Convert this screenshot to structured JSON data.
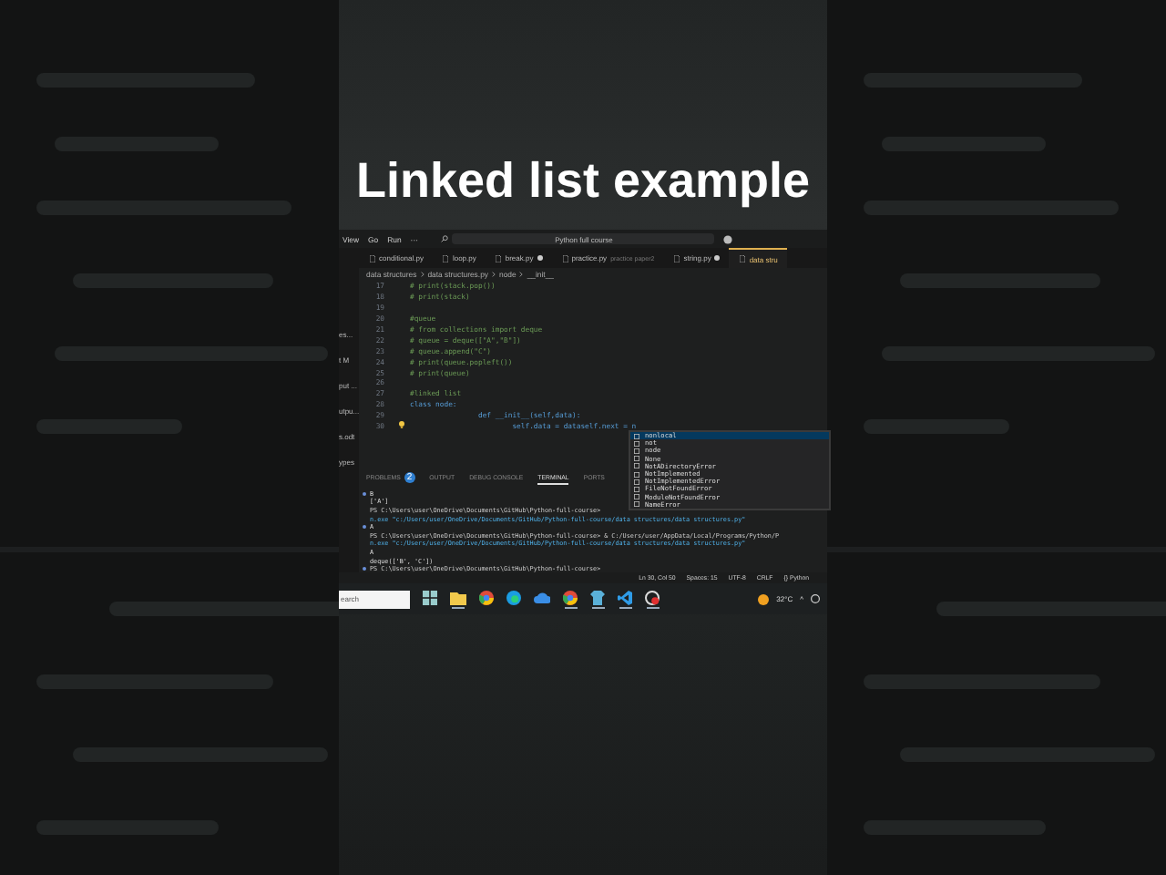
{
  "title": "Linked list example",
  "menu": [
    "View",
    "Go",
    "Run",
    "···"
  ],
  "command_center": {
    "placeholder": "Python full course"
  },
  "tabs": [
    {
      "label": "conditional.py",
      "modified": false,
      "selected": false
    },
    {
      "label": "loop.py",
      "modified": false,
      "selected": false
    },
    {
      "label": "break.py",
      "modified": true,
      "selected": false
    },
    {
      "label": "practice.py",
      "description": "practice paper2",
      "modified": false,
      "selected": false
    },
    {
      "label": "string.py",
      "modified": true,
      "selected": false
    },
    {
      "label": "data stru",
      "modified": false,
      "selected": true
    }
  ],
  "breadcrumb": [
    "data structures",
    "data structures.py",
    "node",
    "__init__"
  ],
  "sidebar": [
    "es...",
    "t M",
    "put ...",
    "utpu...",
    "s.odt",
    "ypes"
  ],
  "code": [
    {
      "num": "17",
      "kind": "comment",
      "text": "# print(stack.pop())",
      "hint": false
    },
    {
      "num": "18",
      "kind": "comment",
      "text": "# print(stack)",
      "hint": false
    },
    {
      "num": "19",
      "kind": "blank",
      "hint": false
    },
    {
      "num": "20",
      "kind": "comment",
      "text": "#queue",
      "hint": false
    },
    {
      "num": "21",
      "kind": "comment",
      "text": "# from collections import deque",
      "hint": false
    },
    {
      "num": "22",
      "kind": "comment",
      "text": "# queue = deque([\"A\",\"B\"])",
      "hint": false
    },
    {
      "num": "23",
      "kind": "comment",
      "text": "# queue.append(\"C\")",
      "hint": false
    },
    {
      "num": "24",
      "kind": "comment",
      "text": "# print(queue.popleft())",
      "hint": false
    },
    {
      "num": "25",
      "kind": "comment",
      "text": "# print(queue)",
      "hint": false
    },
    {
      "num": "26",
      "kind": "blank",
      "hint": false
    },
    {
      "num": "27",
      "kind": "comment",
      "text": "#linked list",
      "hint": false
    },
    {
      "num": "28",
      "kind": "code",
      "text": "class node:",
      "hint": false
    },
    {
      "num": "29",
      "kind": "code",
      "text": "                def __init__(self,data):",
      "hint": false
    },
    {
      "num": "30",
      "kind": "code",
      "text": "                        self.data = dataself.next = n",
      "hint": true
    }
  ],
  "suggestions": [
    {
      "label": "nonlocal",
      "selected": true
    },
    {
      "label": "not",
      "selected": false
    },
    {
      "label": "node",
      "selected": false
    },
    {
      "label": "None",
      "selected": false
    },
    {
      "label": "NotADirectoryError",
      "selected": false
    },
    {
      "label": "NotImplemented",
      "selected": false
    },
    {
      "label": "NotImplementedError",
      "selected": false
    },
    {
      "label": "FileNotFoundError",
      "selected": false
    },
    {
      "label": "ModuleNotFoundError",
      "selected": false
    },
    {
      "label": "NameError",
      "selected": false
    }
  ],
  "panel_tabs": [
    {
      "label": "PROBLEMS",
      "badge": "2",
      "selected": false
    },
    {
      "label": "OUTPUT",
      "selected": false
    },
    {
      "label": "DEBUG CONSOLE",
      "selected": false
    },
    {
      "label": "TERMINAL",
      "selected": true
    },
    {
      "label": "PORTS",
      "selected": false
    }
  ],
  "terminal": [
    {
      "kind": "output",
      "text": "B",
      "dot": true
    },
    {
      "kind": "output",
      "text": "['A']",
      "dot": false
    },
    {
      "kind": "prompt",
      "text": "PS C:\\Users\\user\\OneDrive\\Documents\\GitHub\\Python-full-course>",
      "dot": false
    },
    {
      "kind": "command",
      "text": "n.exe \"c:/Users/user/OneDrive/Documents/GitHub/Python-full-course/data structures/data structures.py\"",
      "dot": false
    },
    {
      "kind": "output",
      "text": "A",
      "dot": true
    },
    {
      "kind": "prompt",
      "text": "PS C:\\Users\\user\\OneDrive\\Documents\\GitHub\\Python-full-course> & C:/Users/user/AppData/Local/Programs/Python/P",
      "dot": false
    },
    {
      "kind": "command",
      "text": "n.exe \"c:/Users/user/OneDrive/Documents/GitHub/Python-full-course/data structures/data structures.py\"",
      "dot": false
    },
    {
      "kind": "output",
      "text": "A",
      "dot": false
    },
    {
      "kind": "output",
      "text": "deque(['B', 'C'])",
      "dot": false
    },
    {
      "kind": "prompt",
      "text": "PS C:\\Users\\user\\OneDrive\\Documents\\GitHub\\Python-full-course>",
      "dot": true
    }
  ],
  "status_bar": [
    "Ln 30, Col 50",
    "Spaces: 15",
    "UTF-8",
    "CRLF",
    "{} Python"
  ],
  "taskbar": {
    "search": "earch",
    "apps": [
      {
        "kind": "start",
        "running": false
      },
      {
        "kind": "folder",
        "running": true
      },
      {
        "kind": "chrome",
        "running": false
      },
      {
        "kind": "edge",
        "running": false
      },
      {
        "kind": "cloud",
        "running": false
      },
      {
        "kind": "chrome",
        "running": true
      },
      {
        "kind": "store",
        "running": true
      },
      {
        "kind": "vscode",
        "running": true
      },
      {
        "kind": "record",
        "running": true
      }
    ],
    "temperature": "32°C",
    "tray_caret": "^"
  }
}
